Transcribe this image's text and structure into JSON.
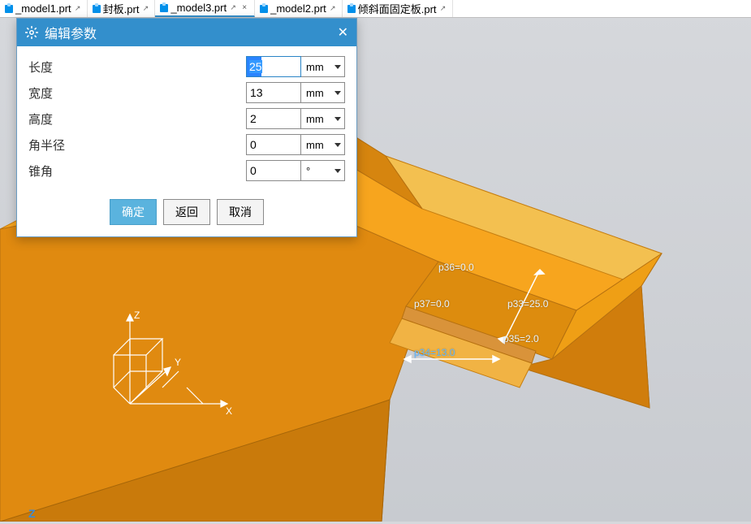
{
  "tabs": [
    {
      "label": "_model1.prt"
    },
    {
      "label": "封板.prt"
    },
    {
      "label": "_model3.prt",
      "active": true
    },
    {
      "label": "_model2.prt"
    },
    {
      "label": "倾斜面固定板.prt"
    }
  ],
  "dialog": {
    "title": "编辑参数",
    "rows": [
      {
        "label": "长度",
        "value": "25",
        "unit": "mm",
        "focused": true
      },
      {
        "label": "宽度",
        "value": "13",
        "unit": "mm"
      },
      {
        "label": "高度",
        "value": "2",
        "unit": "mm"
      },
      {
        "label": "角半径",
        "value": "0",
        "unit": "mm"
      },
      {
        "label": "锥角",
        "value": "0",
        "unit": "°"
      }
    ],
    "buttons": {
      "ok": "确定",
      "back": "返回",
      "cancel": "取消"
    }
  },
  "annotations": {
    "p36": "p36=0.0",
    "p37": "p37=0.0",
    "p33": "p33=25.0",
    "p34": "p34=13.0",
    "p35": "p35=2.0"
  },
  "triad": {
    "x": "X",
    "y": "Y",
    "z": "Z"
  },
  "corner": "Z"
}
